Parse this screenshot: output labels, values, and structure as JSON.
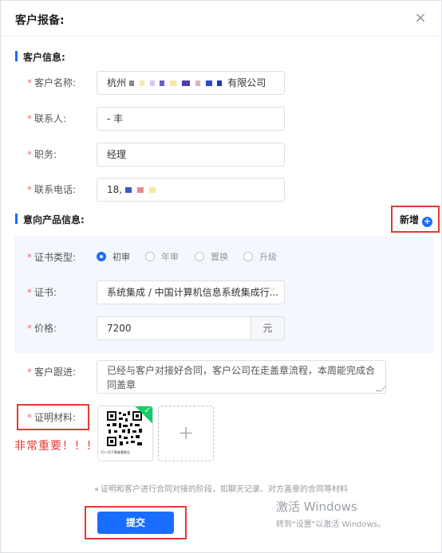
{
  "dialog": {
    "title": "客户报备:",
    "close_symbol": "×"
  },
  "customer_section": {
    "title": "客户信息:",
    "company": {
      "label": "客户名称:",
      "value_prefix": "杭州",
      "value_suffix": "有限公司"
    },
    "contact": {
      "label": "联系人:",
      "value": "- 丰"
    },
    "position": {
      "label": "职务:",
      "value": "经理"
    },
    "phone": {
      "label": "联系电话:",
      "value_prefix": "18,"
    }
  },
  "product_section": {
    "title": "意向产品信息:",
    "add_label": "新增",
    "cert_type": {
      "label": "证书类型:",
      "options": [
        "初审",
        "年审",
        "置换",
        "升级"
      ],
      "selected": "初审"
    },
    "certificate": {
      "label": "证书:",
      "value": "系统集成 / 中国计算机信息系统集成行..."
    },
    "price": {
      "label": "价格:",
      "value": "7200",
      "unit": "元"
    }
  },
  "followup": {
    "label": "客户跟进:",
    "value": "已经与客户对接好合同，客户公司在走盖章流程，本周能完成合同盖章"
  },
  "proof": {
    "label": "证明材料:",
    "thumbnail_caption": "扫一扫下载查看报告",
    "hint": "证明和客户进行合同对接的阶段，如聊天记录、对方盖章的合同等材料"
  },
  "annotation_text": "非常重要！！！",
  "submit_label": "提交",
  "watermark": {
    "line1": "激活 Windows",
    "line2": "转到\"设置\"以激活 Windows。"
  },
  "colors": {
    "primary": "#1a6dff",
    "required": "#f56c6c",
    "annotation": "#e53935",
    "success": "#13ce66"
  }
}
